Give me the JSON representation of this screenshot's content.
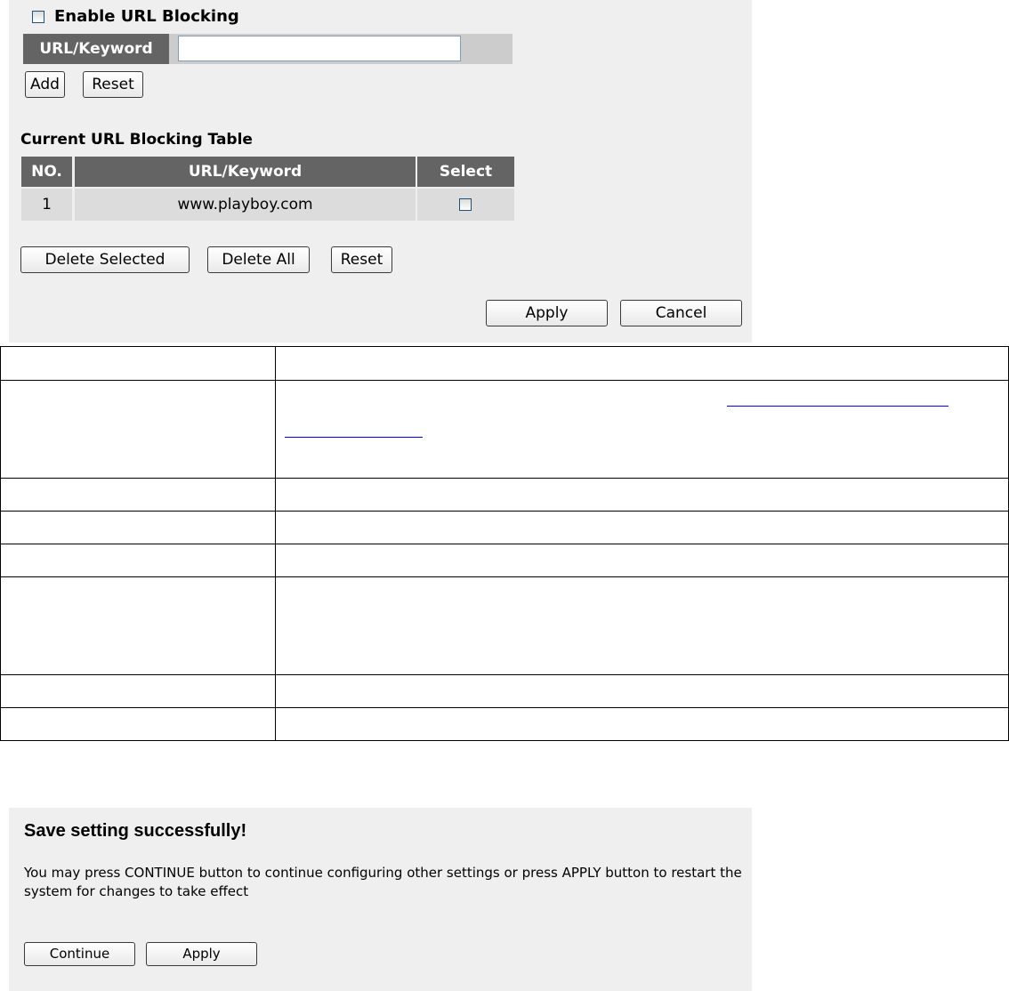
{
  "url_blocking": {
    "enable_label": "Enable URL Blocking",
    "enable_checked": false,
    "url_keyword_label": "URL/Keyword",
    "url_keyword_value": "",
    "add_label": "Add",
    "reset_label": "Reset",
    "table_title": "Current URL Blocking Table",
    "columns": [
      "NO.",
      "URL/Keyword",
      "Select"
    ],
    "rows": [
      {
        "no": "1",
        "url": "www.playboy.com",
        "selected": false
      }
    ],
    "delete_selected_label": "Delete Selected",
    "delete_all_label": "Delete All",
    "table_reset_label": "Reset",
    "apply_label": "Apply",
    "cancel_label": "Cancel"
  },
  "save_dialog": {
    "title": "Save setting successfully!",
    "message": "You may press CONTINUE button to continue configuring other settings or press APPLY button to restart the system for changes to take effect",
    "continue_label": "Continue",
    "apply_label": "Apply"
  }
}
